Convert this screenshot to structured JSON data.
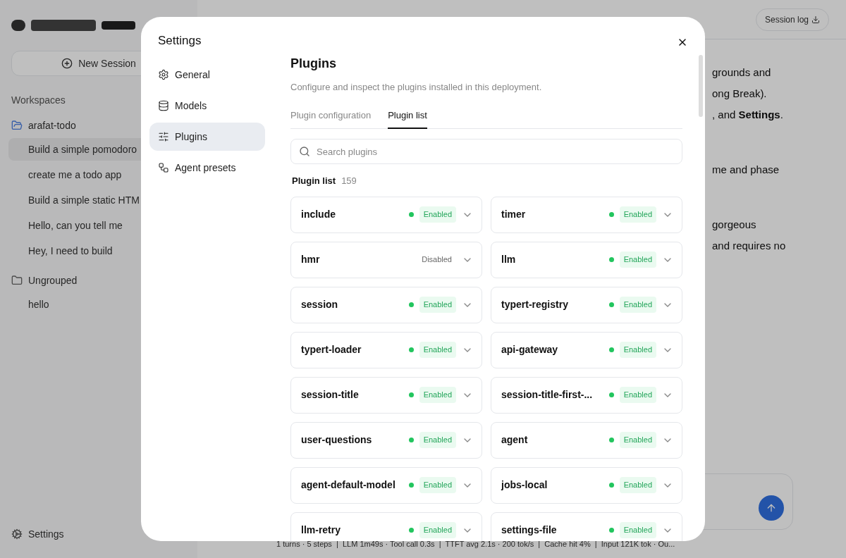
{
  "background": {
    "app": {
      "new_session": "New Session",
      "workspaces_label": "Workspaces",
      "groups": [
        {
          "name": "arafat-todo",
          "kind": "workspace",
          "sessions": [
            {
              "title": "Build a simple pomodoro",
              "selected": true
            },
            {
              "title": "create me a todo app",
              "selected": false
            },
            {
              "title": "Build a simple static HTM",
              "selected": false
            },
            {
              "title": "Hello, can you tell me",
              "selected": false
            },
            {
              "title": "Hey, I need to build",
              "selected": false
            }
          ]
        },
        {
          "name": "Ungrouped",
          "kind": "folder",
          "sessions": [
            {
              "title": "hello",
              "selected": false
            }
          ]
        }
      ],
      "settings": "Settings",
      "session_log": "Session log",
      "message_paragraphs": [
        [
          "grounds and",
          "ong Break).",
          ", and **Settings**."
        ],
        [
          "me and phase"
        ],
        [
          "gorgeous",
          "and requires no"
        ]
      ],
      "status_bar": "1 turns · 5 steps  |  LLM 1m49s · Tool call 0.3s  |  TTFT avg 2.1s · 200 tok/s  |  Cache hit 4%  |  Input 121K tok · Ou..."
    }
  },
  "dialog": {
    "title": "Settings",
    "nav": [
      {
        "label": "General",
        "selected": false
      },
      {
        "label": "Models",
        "selected": false
      },
      {
        "label": "Plugins",
        "selected": true
      },
      {
        "label": "Agent presets",
        "selected": false
      }
    ],
    "heading": "Plugins",
    "description": "Configure and inspect the plugins installed in this deployment.",
    "tabs": [
      {
        "label": "Plugin configuration",
        "selected": false
      },
      {
        "label": "Plugin list",
        "selected": true
      }
    ],
    "search": {
      "placeholder": "Search plugins"
    },
    "list_label": "Plugin list",
    "count": "159",
    "plugins": [
      {
        "name": "include",
        "status": "Enabled",
        "enabled": true
      },
      {
        "name": "timer",
        "status": "Enabled",
        "enabled": true
      },
      {
        "name": "hmr",
        "status": "Disabled",
        "enabled": false
      },
      {
        "name": "llm",
        "status": "Enabled",
        "enabled": true
      },
      {
        "name": "session",
        "status": "Enabled",
        "enabled": true
      },
      {
        "name": "typert-registry",
        "status": "Enabled",
        "enabled": true
      },
      {
        "name": "typert-loader",
        "status": "Enabled",
        "enabled": true
      },
      {
        "name": "api-gateway",
        "status": "Enabled",
        "enabled": true
      },
      {
        "name": "session-title",
        "status": "Enabled",
        "enabled": true
      },
      {
        "name": "session-title-first-...",
        "status": "Enabled",
        "enabled": true
      },
      {
        "name": "user-questions",
        "status": "Enabled",
        "enabled": true
      },
      {
        "name": "agent",
        "status": "Enabled",
        "enabled": true
      },
      {
        "name": "agent-default-model",
        "status": "Enabled",
        "enabled": true
      },
      {
        "name": "jobs-local",
        "status": "Enabled",
        "enabled": true
      },
      {
        "name": "llm-retry",
        "status": "Enabled",
        "enabled": true
      },
      {
        "name": "settings-file",
        "status": "Enabled",
        "enabled": true
      }
    ]
  }
}
